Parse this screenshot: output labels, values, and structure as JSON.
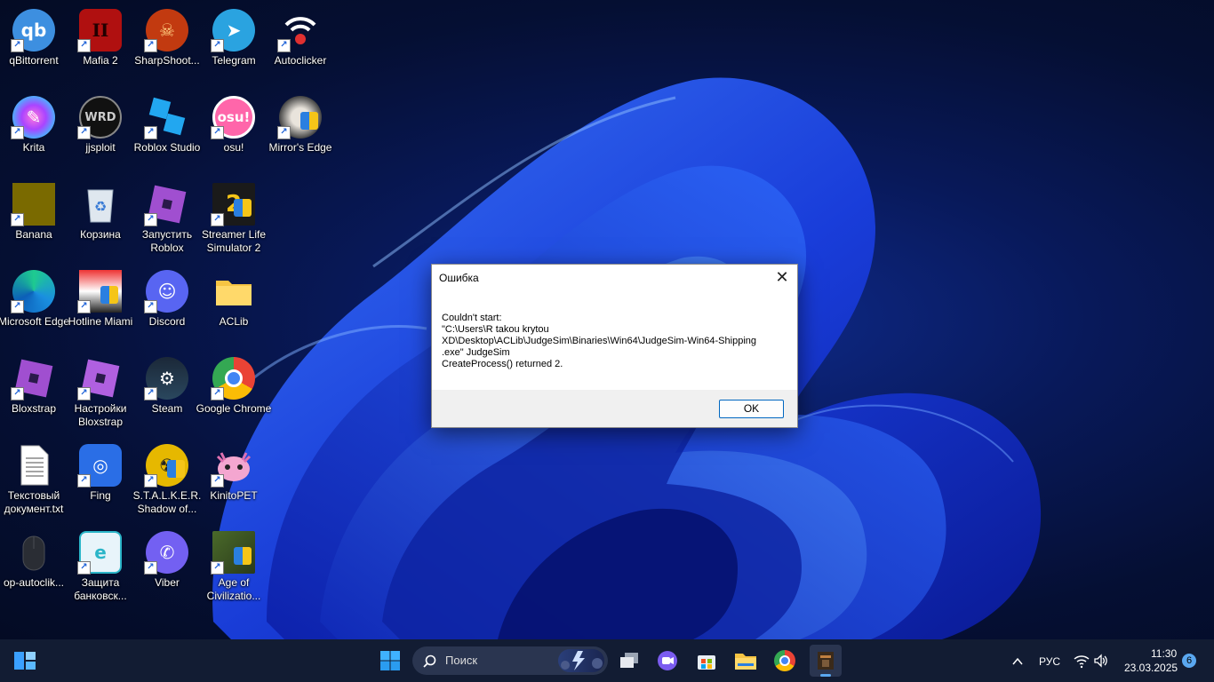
{
  "desktop": {
    "icons": [
      {
        "label": "qBittorrent"
      },
      {
        "label": "Mafia 2"
      },
      {
        "label": "SharpShoot..."
      },
      {
        "label": "Telegram"
      },
      {
        "label": "Autoclicker"
      },
      {
        "label": "Krita"
      },
      {
        "label": "jjsploit"
      },
      {
        "label": "Roblox Studio"
      },
      {
        "label": "osu!"
      },
      {
        "label": "Mirror's Edge"
      },
      {
        "label": "Banana"
      },
      {
        "label": "Корзина"
      },
      {
        "label": "Запустить Roblox"
      },
      {
        "label": "Streamer Life Simulator 2"
      },
      {
        "label": "Microsoft Edge"
      },
      {
        "label": "Hotline Miami"
      },
      {
        "label": "Discord"
      },
      {
        "label": "ACLib"
      },
      {
        "label": "Bloxstrap"
      },
      {
        "label": "Настройки Bloxstrap"
      },
      {
        "label": "Steam"
      },
      {
        "label": "Google Chrome"
      },
      {
        "label": "Текстовый документ.txt"
      },
      {
        "label": "Fing"
      },
      {
        "label": "S.T.A.L.K.E.R. Shadow of..."
      },
      {
        "label": "KinitoPET"
      },
      {
        "label": "op-autoclik..."
      },
      {
        "label": "Защита банковск..."
      },
      {
        "label": "Viber"
      },
      {
        "label": "Age of Civilizatio..."
      }
    ]
  },
  "dialog": {
    "title": "Ошибка",
    "message_lines": [
      "Couldn't start:",
      "\"C:\\Users\\R takou krytou",
      "XD\\Desktop\\ACLib\\JudgeSim\\Binaries\\Win64\\JudgeSim-Win64-Shipping",
      ".exe\" JudgeSim",
      "CreateProcess() returned 2."
    ],
    "ok_label": "OK",
    "close_glyph": "✕"
  },
  "taskbar": {
    "search_placeholder": "Поиск",
    "language": "РУС",
    "time": "11:30",
    "date": "23.03.2025",
    "notification_count": "6"
  }
}
